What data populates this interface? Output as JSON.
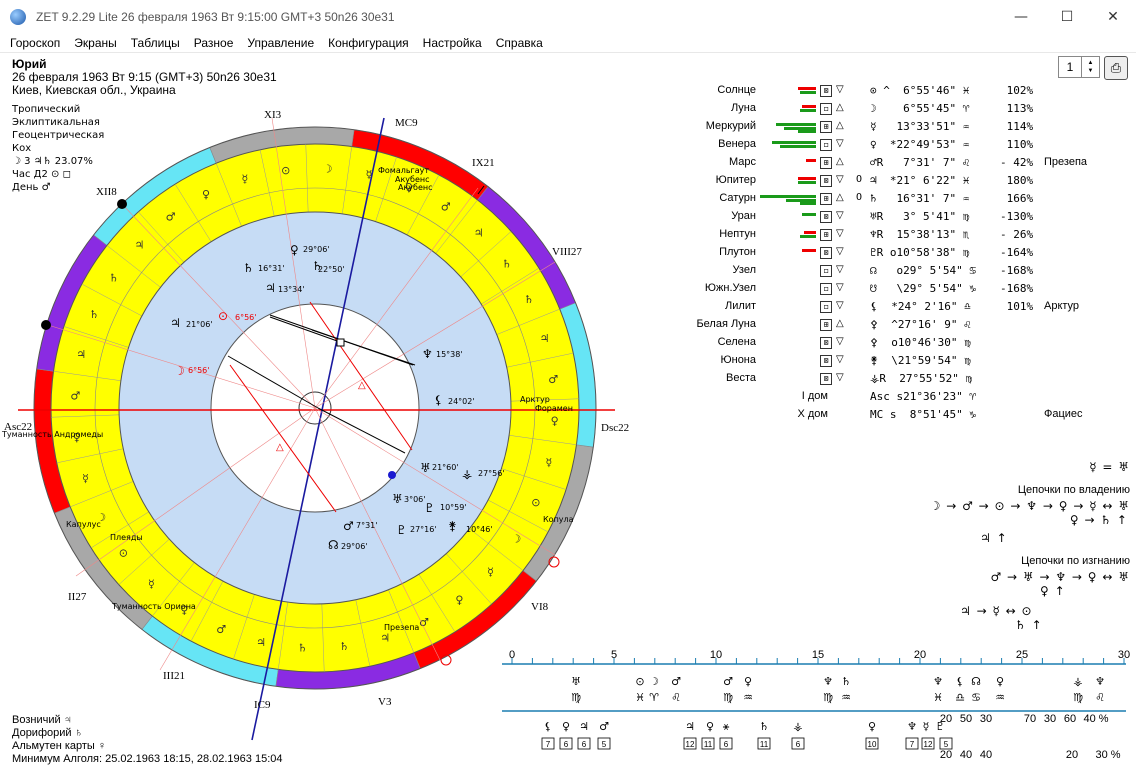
{
  "window": {
    "title": "ZET 9.2.29 Lite   26 февраля 1963  Вт   9:15:00 GMT+3 50n26  30e31",
    "minimize": "—",
    "maximize": "☐",
    "close": "✕"
  },
  "menu": [
    "Гороскоп",
    "Экраны",
    "Таблицы",
    "Разное",
    "Управление",
    "Конфигурация",
    "Настройка",
    "Справка"
  ],
  "person": {
    "name": "Юрий",
    "datetime": "26 февраля 1963   Вт    9:15 (GMT+3) 50n26  30e31",
    "place": "Киев, Киевская обл., Украина"
  },
  "settings": [
    "Тропический",
    "Эклиптикальная",
    "Геоцентрическая",
    "Кох",
    "☽  3  ♃♄ 23.07%",
    "Час Д2 ⊙ ◻",
    "День ♂"
  ],
  "spinner": {
    "value": "1"
  },
  "print_icon": "⎙",
  "planets": [
    {
      "name": "Солнце",
      "box": "⊠",
      "tri": "▽",
      "sym": "⊙ ^  6°55'46\" ♓",
      "pct": " 102%",
      "star": ""
    },
    {
      "name": "Луна",
      "box": "◻",
      "tri": "△",
      "sym": "☽    6°55'45\" ♈",
      "pct": " 113%",
      "star": ""
    },
    {
      "name": "Меркурий",
      "box": "⊞",
      "tri": "△",
      "sym": "☿   13°33'51\" ♒",
      "pct": " 114%",
      "star": ""
    },
    {
      "name": "Венера",
      "box": "◻",
      "tri": "▽",
      "sym": "♀  *22°49'53\" ♒",
      "pct": " 110%",
      "star": ""
    },
    {
      "name": "Марс",
      "box": "⊞",
      "tri": "△",
      "sym": "♂R   7°31' 7\" ♌",
      "pct": "- 42%",
      "star": "Презепа"
    },
    {
      "name": "Юпитер",
      "box": "⊠",
      "tri": "▽",
      "ring": "O",
      "sym": "♃  *21° 6'22\" ♓",
      "pct": " 180%",
      "star": ""
    },
    {
      "name": "Сатурн",
      "box": "⊞",
      "tri": "△",
      "ring": "O",
      "sym": "♄   16°31' 7\" ♒",
      "pct": " 166%",
      "star": ""
    },
    {
      "name": "Уран",
      "box": "⊠",
      "tri": "▽",
      "sym": "♅R   3° 5'41\" ♍",
      "pct": "-130%",
      "star": ""
    },
    {
      "name": "Нептун",
      "box": "⊞",
      "tri": "▽",
      "sym": "♆R  15°38'13\" ♏",
      "pct": "- 26%",
      "star": ""
    },
    {
      "name": "Плутон",
      "box": "⊠",
      "tri": "▽",
      "sym": "♇R o10°58'38\" ♍",
      "pct": "-164%",
      "star": ""
    },
    {
      "name": "Узел",
      "box": "◻",
      "tri": "▽",
      "sym": "☊   o29° 5'54\" ♋",
      "pct": "-168%",
      "star": ""
    },
    {
      "name": "Южн.Узел",
      "box": "◻",
      "tri": "▽",
      "sym": "☋   \\29° 5'54\" ♑",
      "pct": "-168%",
      "star": ""
    },
    {
      "name": "Лилит",
      "box": "◻",
      "tri": "▽",
      "sym": "⚸  *24° 2'16\" ♎",
      "pct": " 101%",
      "star": "Арктур"
    },
    {
      "name": "Белая Луна",
      "box": "⊞",
      "tri": "△",
      "sym": "⚴  ^27°16' 9\" ♌",
      "pct": "",
      "star": ""
    },
    {
      "name": "Селена",
      "box": "⊠",
      "tri": "▽",
      "sym": "⚴  o10°46'30\" ♍",
      "pct": "",
      "star": ""
    },
    {
      "name": "Юнона",
      "box": "⊠",
      "tri": "▽",
      "sym": "⚵  \\21°59'54\" ♍",
      "pct": "",
      "star": ""
    },
    {
      "name": "Веста",
      "box": "⊠",
      "tri": "▽",
      "sym": "⚶R  27°55'52\" ♍",
      "pct": "",
      "star": ""
    }
  ],
  "houses_rows": [
    {
      "name": "I дом",
      "sym": "Asc s21°36'23\" ♈",
      "extra": ""
    },
    {
      "name": "X дом",
      "sym": "MC s  8°51'45\" ♑",
      "extra": "Фациес"
    }
  ],
  "chains": {
    "top": "☿ = ♅",
    "own_title": "Цепочки по владению",
    "own1": "☽ → ♂ → ⊙ → ♆ → ♀ → ☿ ↔ ♅",
    "own2": "♀ → ♄ ↑",
    "own3": "♃ ↑",
    "exile_title": "Цепочки по изгнанию",
    "exile1": "♂ → ♅ → ♆ → ♀ ↔ ♅",
    "exile2": "♀ ↑",
    "exile3": "♃ → ☿ ↔ ⊙",
    "exile4": "♄ ↑"
  },
  "bottom": {
    "vozn": "Возничий  ♃",
    "dor": "Дорифорий  ♄",
    "alm": "Альмутен карты  ♀",
    "algol": "Минимум Алголя: 25.02.1963 18:15,  28.02.1963 15:04"
  },
  "scale": {
    "ticks": [
      "0",
      "5",
      "10",
      "15",
      "20",
      "25",
      "30"
    ],
    "pct_row1": [
      "20",
      "50",
      "30",
      "70",
      "30",
      "60",
      "40 %"
    ],
    "pct_row2": [
      "20",
      "40",
      "40",
      "20",
      "30 %"
    ],
    "boxes": [
      "7",
      "6",
      "6",
      "5",
      "12",
      "11",
      "6",
      "11",
      "6",
      "10",
      "7",
      "12",
      "5"
    ]
  },
  "wheel": {
    "house_labels": [
      "XII8",
      "XI3",
      "MC9",
      "IX21",
      "VIII27",
      "Dsc22",
      "VI8",
      "V3",
      "IC9",
      "III21",
      "II27",
      "Asc22"
    ],
    "degree_labels": [
      "29°06'",
      "22°50'",
      "16°31'",
      "13°34'",
      "21°06'",
      "6°56'",
      "6°56'",
      "15°38'",
      "24°02'",
      "21°60'",
      "27°56'",
      "3°06'",
      "10°59'",
      "27°16'",
      "10°46'",
      "7°31'",
      "29°06'"
    ],
    "star_labels": [
      "Фомальгаут",
      "Акубенс",
      "Акубенс",
      "Арктур",
      "Форамен",
      "Копула",
      "Презепа",
      "Туманность Ориона",
      "Плеяды",
      "Капулус",
      "Туманность Андромеды"
    ]
  }
}
